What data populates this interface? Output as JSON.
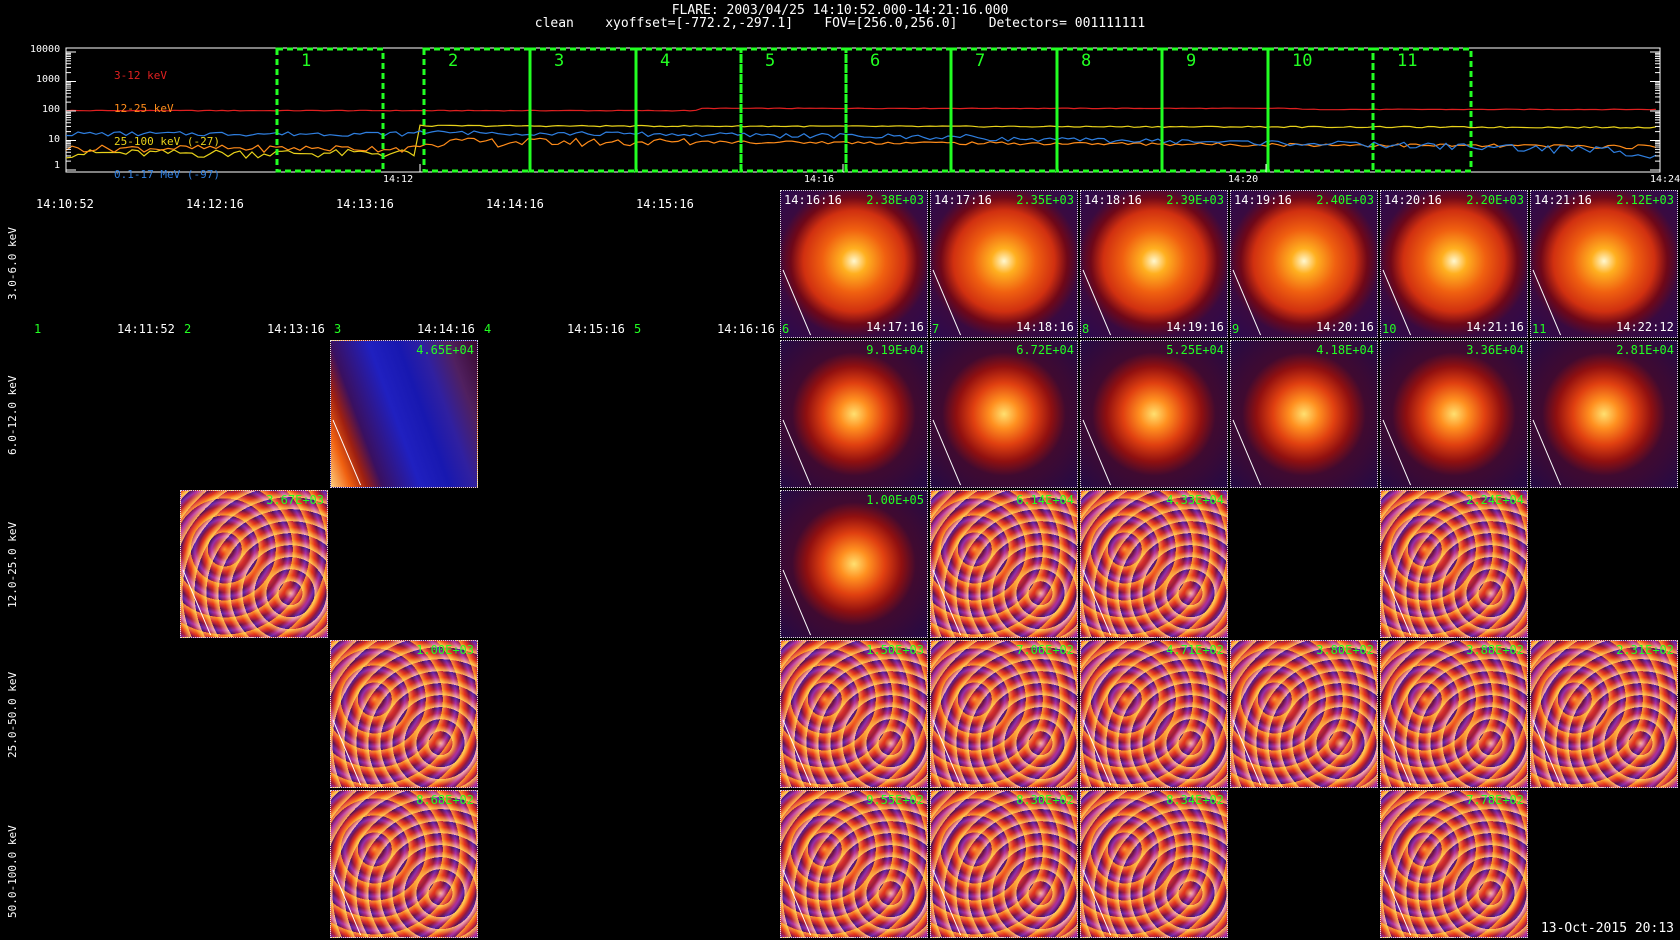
{
  "header": {
    "line1": "FLARE: 2003/04/25 14:10:52.000-14:21:16.000",
    "line2": "clean    xyoffset=[-772.2,-297.1]    FOV=[256.0,256.0]    Detectors= 001111111"
  },
  "lightcurve": {
    "y_ticks": [
      "10000",
      "1000",
      "100",
      "10",
      "1"
    ],
    "x_ticks": [
      "14:12",
      "14:16",
      "14:20",
      "14:24"
    ],
    "legend": [
      {
        "label": "3-12 keV",
        "color": "#e02020"
      },
      {
        "label": "12-25 keV",
        "color": "#ff8c1a"
      },
      {
        "label": "25-100 keV (-27)",
        "color": "#e8d21a"
      },
      {
        "label": "0.1-17 MeV (-97)",
        "color": "#2f7fe0"
      }
    ],
    "boxes": [
      "1",
      "2",
      "3",
      "4",
      "5",
      "6",
      "7",
      "8",
      "9",
      "10",
      "11"
    ]
  },
  "top_times": [
    "14:10:52",
    "14:12:16",
    "14:13:16",
    "14:14:16",
    "14:15:16"
  ],
  "mid_labels": [
    {
      "num": "1",
      "time": "14:11:52"
    },
    {
      "num": "2",
      "time": "14:13:16"
    },
    {
      "num": "3",
      "time": "14:14:16"
    },
    {
      "num": "4",
      "time": "14:15:16"
    },
    {
      "num": "5",
      "time": "14:16:16"
    }
  ],
  "energy_rows": [
    "3.0-6.0 keV",
    "6.0-12.0 keV",
    "12.0-25.0 keV",
    "25.0-50.0 keV",
    "50.0-100.0 keV"
  ],
  "panels_row1": [
    {
      "time": "14:16:16",
      "val": "2.38E+03",
      "foot": "14:17:16",
      "num": "6"
    },
    {
      "time": "14:17:16",
      "val": "2.35E+03",
      "foot": "14:18:16",
      "num": "7"
    },
    {
      "time": "14:18:16",
      "val": "2.39E+03",
      "foot": "14:19:16",
      "num": "8"
    },
    {
      "time": "14:19:16",
      "val": "2.40E+03",
      "foot": "14:20:16",
      "num": "9"
    },
    {
      "time": "14:20:16",
      "val": "2.20E+03",
      "foot": "14:21:16",
      "num": "10"
    },
    {
      "time": "14:21:16",
      "val": "2.12E+03",
      "foot": "14:22:12",
      "num": "11"
    }
  ],
  "panels_row2": [
    "4.65E+04",
    "9.19E+04",
    "6.72E+04",
    "5.25E+04",
    "4.18E+04",
    "3.36E+04",
    "2.81E+04"
  ],
  "panels_row3": [
    "3.67E+03",
    "1.00E+05",
    "6.14E+04",
    "4.33E+04",
    "2.24E+04"
  ],
  "panels_row4": [
    "1.00E+03",
    "1.50E+03",
    "7.06E+02",
    "4.71E+02",
    "3.80E+02",
    "3.88E+02",
    "2.31E+02"
  ],
  "panels_row5": [
    "8.68E+02",
    "9.55E+02",
    "8.30E+02",
    "8.34E+02",
    "7.78E+02"
  ],
  "date_stamp": "13-Oct-2015 20:13"
}
